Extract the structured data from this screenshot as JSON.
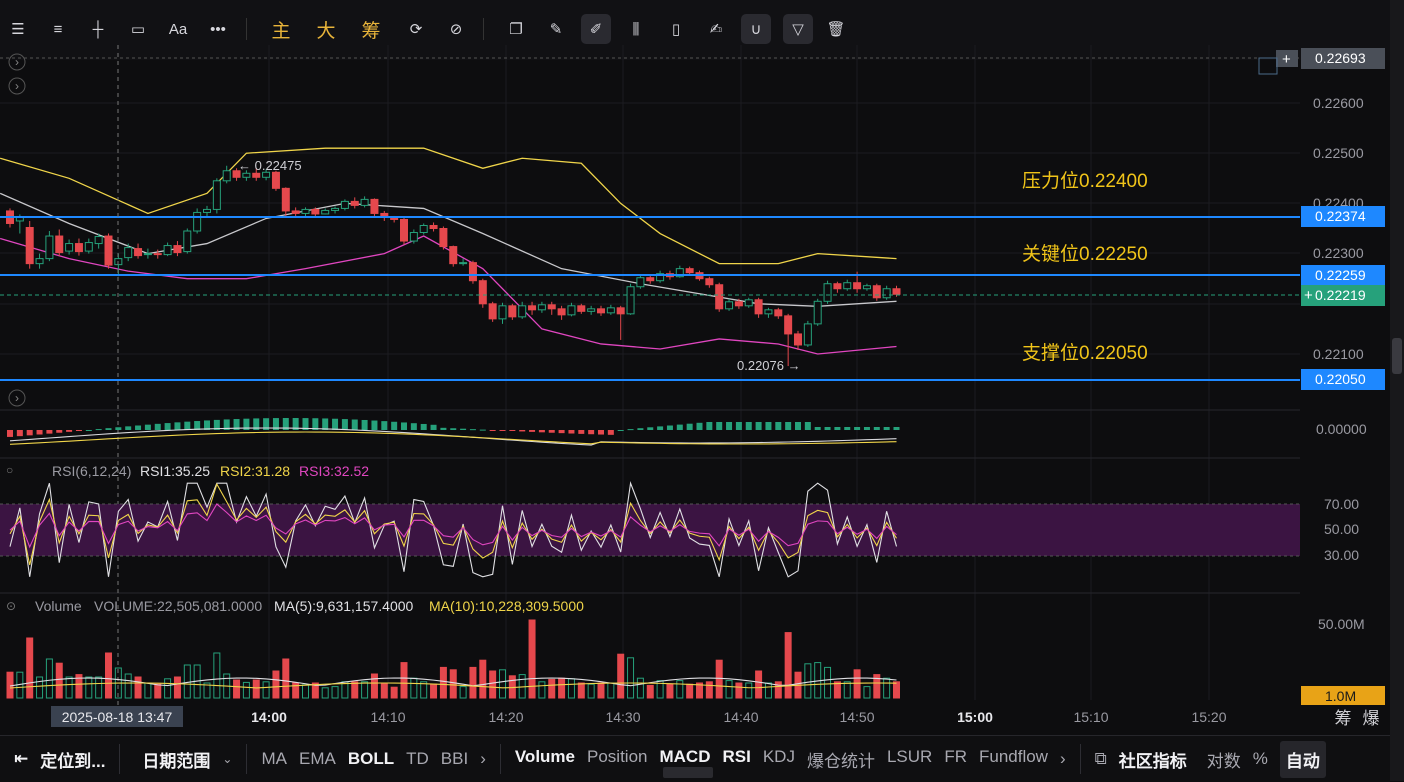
{
  "toolbar": {
    "left_tools": [
      "menu-icon",
      "list-icon",
      "crosshair-icon",
      "rectangle-icon",
      "Aa",
      "more-icon"
    ],
    "cn_tools": [
      "主",
      "大",
      "筹"
    ],
    "right_tools": [
      "rotate-icon",
      "pencil-slash-icon",
      "copy-icon",
      "ruler-icon",
      "pen-icon",
      "candles-icon",
      "clipboard-icon",
      "edit-icon",
      "magnet-icon",
      "filter-icon",
      "trash-icon"
    ]
  },
  "chart_data": {
    "type": "candlestick",
    "x_ticks": [
      "14:00",
      "14:10",
      "14:20",
      "14:30",
      "14:40",
      "14:50",
      "15:00",
      "15:10",
      "15:20"
    ],
    "crosshair_time": "2025-08-18 13:47",
    "price_ticks": [
      "0.22600",
      "0.22500",
      "0.22400",
      "0.22300",
      "0.22100"
    ],
    "price_labels": [
      {
        "value": "0.22693",
        "color": "#4a4f58"
      },
      {
        "value": "0.22374",
        "color": "#1e88ff"
      },
      {
        "value": "0.22259",
        "color": "#1e88ff"
      },
      {
        "value": "0.22219",
        "color": "#26a17b"
      },
      {
        "value": "0.22050",
        "color": "#1e88ff"
      }
    ],
    "annotations": [
      {
        "text": "压力位0.22400",
        "color": "#f0c419"
      },
      {
        "text": "关键位0.22250",
        "color": "#f0c419"
      },
      {
        "text": "支撑位0.22050",
        "color": "#f0c419"
      }
    ],
    "high_marker": "← 0.22475",
    "low_marker": "0.22076 →",
    "macd_tick": "0.00000",
    "rsi": {
      "label": "RSI(6,12,24)",
      "rsi1": "RSI1:35.25",
      "rsi2": "RSI2:31.28",
      "rsi3": "RSI3:32.52",
      "ticks": [
        "70.00",
        "50.00",
        "30.00"
      ]
    },
    "volume": {
      "label": "Volume",
      "volume": "VOLUME:22,505,081.0000",
      "ma5": "MA(5):9,631,157.4000",
      "ma10": "MA(10):10,228,309.5000",
      "ticks": [
        "50.00M"
      ],
      "current": "1.0M"
    },
    "candles": [
      [
        0.22385,
        0.22385,
        0.2236,
        0.22352,
        0.2239
      ],
      [
        0.22365,
        0.22348,
        0.22372,
        0.2234,
        0.22378
      ],
      [
        0.22352,
        0.22355,
        0.2228,
        0.2227,
        0.22365
      ],
      [
        0.2228,
        0.2229,
        0.2229,
        0.2227,
        0.223
      ],
      [
        0.2229,
        0.22292,
        0.22335,
        0.22285,
        0.22345
      ],
      [
        0.22335,
        0.22338,
        0.22302,
        0.22295,
        0.22348
      ],
      [
        0.22305,
        0.2231,
        0.2232,
        0.22298,
        0.22328
      ],
      [
        0.2232,
        0.22324,
        0.22304,
        0.22296,
        0.2233
      ],
      [
        0.22305,
        0.22308,
        0.22322,
        0.223,
        0.2233
      ],
      [
        0.2232,
        0.22324,
        0.22334,
        0.2231,
        0.2234
      ],
      [
        0.22335,
        0.22334,
        0.22277,
        0.2227,
        0.2234
      ],
      [
        0.22278,
        0.22275,
        0.2229,
        0.22255,
        0.223
      ],
      [
        0.22292,
        0.22296,
        0.22312,
        0.22285,
        0.2232
      ],
      [
        0.2231,
        0.22314,
        0.22296,
        0.2229,
        0.2232
      ],
      [
        0.22298,
        0.22302,
        0.223,
        0.2229,
        0.2231
      ],
      [
        0.223,
        0.22303,
        0.22298,
        0.2229,
        0.22308
      ],
      [
        0.22298,
        0.22302,
        0.22316,
        0.22295,
        0.22322
      ],
      [
        0.22316,
        0.22318,
        0.22302,
        0.22295,
        0.22325
      ],
      [
        0.22304,
        0.22308,
        0.22345,
        0.223,
        0.2235
      ],
      [
        0.22345,
        0.22348,
        0.22382,
        0.2234,
        0.2239
      ],
      [
        0.22382,
        0.2238,
        0.22388,
        0.22375,
        0.22395
      ],
      [
        0.22388,
        0.22386,
        0.22445,
        0.2238,
        0.2245
      ],
      [
        0.22445,
        0.22442,
        0.22465,
        0.2244,
        0.22475
      ],
      [
        0.22465,
        0.22462,
        0.22452,
        0.22445,
        0.2247
      ],
      [
        0.22452,
        0.22455,
        0.2246,
        0.22445,
        0.22466
      ],
      [
        0.2246,
        0.22462,
        0.22452,
        0.22445,
        0.2247
      ],
      [
        0.22452,
        0.22455,
        0.22462,
        0.22446,
        0.22468
      ],
      [
        0.22462,
        0.22458,
        0.2243,
        0.22425,
        0.22465
      ],
      [
        0.2243,
        0.22428,
        0.22385,
        0.22372,
        0.22432
      ],
      [
        0.22385,
        0.22388,
        0.2238,
        0.22372,
        0.22392
      ],
      [
        0.2238,
        0.22383,
        0.22388,
        0.22375,
        0.22392
      ],
      [
        0.22388,
        0.22386,
        0.22379,
        0.22372,
        0.22392
      ],
      [
        0.22379,
        0.22382,
        0.22386,
        0.22378,
        0.2239
      ],
      [
        0.22386,
        0.22389,
        0.2239,
        0.2238,
        0.22394
      ],
      [
        0.2239,
        0.22393,
        0.22404,
        0.22386,
        0.22408
      ],
      [
        0.22404,
        0.22406,
        0.22396,
        0.2239,
        0.22412
      ],
      [
        0.22396,
        0.22398,
        0.22408,
        0.22392,
        0.22414
      ],
      [
        0.22408,
        0.22405,
        0.2238,
        0.22375,
        0.2241
      ],
      [
        0.2238,
        0.22382,
        0.22372,
        0.22365,
        0.22385
      ],
      [
        0.22372,
        0.2237,
        0.22368,
        0.22362,
        0.22375
      ],
      [
        0.22368,
        0.22366,
        0.22325,
        0.22318,
        0.22372
      ],
      [
        0.22325,
        0.22328,
        0.22342,
        0.2232,
        0.22348
      ],
      [
        0.22342,
        0.22345,
        0.22356,
        0.22338,
        0.2236
      ],
      [
        0.22356,
        0.22358,
        0.2235,
        0.22344,
        0.22362
      ],
      [
        0.2235,
        0.22346,
        0.22314,
        0.22308,
        0.22354
      ],
      [
        0.22314,
        0.2231,
        0.2228,
        0.22274,
        0.22316
      ],
      [
        0.2228,
        0.22284,
        0.22282,
        0.22276,
        0.2229
      ],
      [
        0.22282,
        0.2228,
        0.22246,
        0.2224,
        0.22286
      ],
      [
        0.22246,
        0.22244,
        0.222,
        0.22192,
        0.2225
      ],
      [
        0.222,
        0.22198,
        0.2217,
        0.22164,
        0.22204
      ],
      [
        0.2217,
        0.22174,
        0.22196,
        0.2216,
        0.22202
      ],
      [
        0.22196,
        0.22194,
        0.22174,
        0.22168,
        0.222
      ],
      [
        0.22174,
        0.22178,
        0.22196,
        0.2217,
        0.22204
      ],
      [
        0.22196,
        0.22199,
        0.22188,
        0.22178,
        0.22204
      ],
      [
        0.22188,
        0.22191,
        0.22198,
        0.22182,
        0.22204
      ],
      [
        0.22198,
        0.22196,
        0.2219,
        0.22178,
        0.22204
      ],
      [
        0.2219,
        0.22188,
        0.22178,
        0.22168,
        0.22196
      ],
      [
        0.22178,
        0.22182,
        0.22196,
        0.22175,
        0.22202
      ],
      [
        0.22196,
        0.22194,
        0.22185,
        0.2218,
        0.222
      ],
      [
        0.22185,
        0.22188,
        0.2219,
        0.22178,
        0.22196
      ],
      [
        0.2219,
        0.22188,
        0.22182,
        0.22176,
        0.22196
      ],
      [
        0.22182,
        0.22186,
        0.22192,
        0.22178,
        0.22198
      ],
      [
        0.22192,
        0.22189,
        0.2218,
        0.22128,
        0.22196
      ],
      [
        0.2218,
        0.22184,
        0.22234,
        0.22178,
        0.2224
      ],
      [
        0.22234,
        0.22236,
        0.22252,
        0.2223,
        0.22258
      ],
      [
        0.22252,
        0.2225,
        0.22246,
        0.2224,
        0.22256
      ],
      [
        0.22246,
        0.22248,
        0.2226,
        0.22242,
        0.22266
      ],
      [
        0.2226,
        0.22258,
        0.22254,
        0.22248,
        0.22266
      ],
      [
        0.22254,
        0.22257,
        0.2227,
        0.22252,
        0.22276
      ],
      [
        0.2227,
        0.22268,
        0.22262,
        0.22256,
        0.22274
      ],
      [
        0.22262,
        0.2226,
        0.2225,
        0.22246,
        0.22266
      ],
      [
        0.2225,
        0.22248,
        0.22238,
        0.22232,
        0.22254
      ],
      [
        0.22238,
        0.22236,
        0.2219,
        0.22184,
        0.22242
      ],
      [
        0.2219,
        0.22193,
        0.22204,
        0.22186,
        0.2221
      ],
      [
        0.22204,
        0.22206,
        0.22196,
        0.2219,
        0.2221
      ],
      [
        0.22196,
        0.22199,
        0.22208,
        0.22192,
        0.22212
      ],
      [
        0.22208,
        0.22206,
        0.2218,
        0.22172,
        0.22212
      ],
      [
        0.2218,
        0.22183,
        0.22188,
        0.22172,
        0.22192
      ],
      [
        0.22188,
        0.22186,
        0.22176,
        0.2217,
        0.22192
      ],
      [
        0.22176,
        0.22172,
        0.2214,
        0.22076,
        0.2218
      ],
      [
        0.2214,
        0.22138,
        0.22118,
        0.22108,
        0.22146
      ],
      [
        0.22118,
        0.22122,
        0.2216,
        0.22114,
        0.22166
      ],
      [
        0.2216,
        0.22163,
        0.22205,
        0.22156,
        0.2221
      ],
      [
        0.22205,
        0.22208,
        0.2224,
        0.222,
        0.22246
      ],
      [
        0.2224,
        0.22238,
        0.2223,
        0.22222,
        0.22244
      ],
      [
        0.2223,
        0.22233,
        0.22242,
        0.22226,
        0.22248
      ],
      [
        0.22242,
        0.2224,
        0.2223,
        0.22222,
        0.22264
      ],
      [
        0.2223,
        0.22232,
        0.22236,
        0.22226,
        0.2224
      ],
      [
        0.22236,
        0.22234,
        0.22212,
        0.22206,
        0.2224
      ],
      [
        0.22212,
        0.22215,
        0.2223,
        0.22208,
        0.22236
      ],
      [
        0.2223,
        0.22232,
        0.22219,
        0.22214,
        0.22236
      ]
    ]
  },
  "bottom_bar": {
    "locate": "定位到...",
    "date_range": "日期范围",
    "indicators_left": [
      "MA",
      "EMA",
      "BOLL",
      "TD",
      "BBI"
    ],
    "indicators_left_active": [
      "BOLL"
    ],
    "indicators_right": [
      "Volume",
      "Position",
      "MACD",
      "RSI",
      "KDJ",
      "爆仓统计",
      "LSUR",
      "FR",
      "Fundflow"
    ],
    "indicators_right_active": [
      "Volume",
      "MACD",
      "RSI"
    ],
    "community": "社区指标",
    "log": "对数",
    "percent": "%",
    "auto": "自动"
  },
  "axis_corner": {
    "chip": "筹",
    "boom": "爆"
  },
  "colors": {
    "up": "#26a17b",
    "down": "#e5484d",
    "yellow": "#f0d54a",
    "pink": "#e046c0",
    "blue": "#1e88ff",
    "rsi_band": "#3b1442"
  }
}
